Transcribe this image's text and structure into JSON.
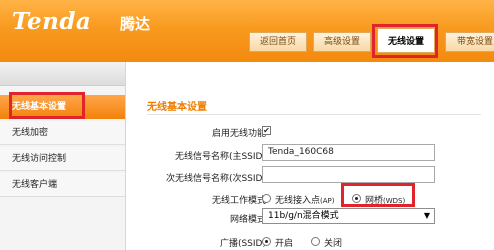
{
  "header": {
    "logo_text": "Tenda",
    "logo_cn": "腾达"
  },
  "nav": {
    "tabs": [
      {
        "label": "返回首页"
      },
      {
        "label": "高级设置"
      },
      {
        "label": "无线设置",
        "active": true
      },
      {
        "label": "带宽设置"
      }
    ]
  },
  "sidebar": {
    "items": [
      {
        "label": "无线基本设置",
        "active": true
      },
      {
        "label": "无线加密"
      },
      {
        "label": "无线访问控制"
      },
      {
        "label": "无线客户端"
      }
    ]
  },
  "main": {
    "section_title": "无线基本设置",
    "enable_wireless": {
      "label": "启用无线功能",
      "checked": true
    },
    "primary_ssid": {
      "label": "无线信号名称(主SSID)",
      "value": "Tenda_160C68"
    },
    "secondary_ssid": {
      "label": "次无线信号名称(次SSID)",
      "value": ""
    },
    "work_mode": {
      "label": "无线工作模式",
      "options": [
        {
          "main": "无线接入点",
          "sub": "(AP)",
          "checked": false
        },
        {
          "main": "网桥",
          "sub": "(WDS)",
          "checked": true
        }
      ]
    },
    "network_mode": {
      "label": "网络模式",
      "value": "11b/g/n混合模式"
    },
    "broadcast": {
      "label": "广播(SSID)",
      "options": [
        {
          "label": "开启",
          "checked": true
        },
        {
          "label": "关闭",
          "checked": false
        }
      ]
    }
  },
  "colors": {
    "accent": "#f38a0e",
    "highlight": "#e0242a",
    "title": "#ef7d00"
  }
}
